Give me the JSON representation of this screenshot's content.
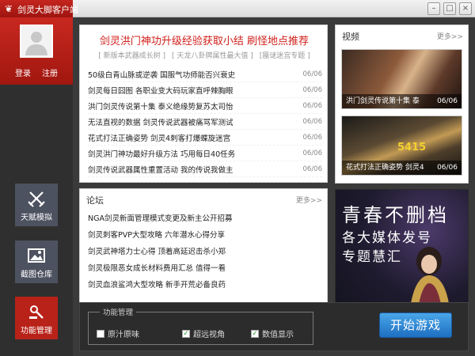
{
  "window": {
    "title": "剑灵大脚客户端",
    "logo_icon": "paw-icon",
    "controls": {
      "minimize": "–",
      "maximize": "□",
      "close": "×"
    }
  },
  "sidebar": {
    "login": "登录",
    "register": "注册",
    "nav": [
      {
        "label": "天赋模拟",
        "icon": "crossed-swords-icon"
      },
      {
        "label": "截图仓库",
        "icon": "picture-icon"
      },
      {
        "label": "功能管理",
        "icon": "tools-icon",
        "active": true
      }
    ]
  },
  "news": {
    "headline": "剑灵洪门神功升级经验获取小结 刷怪地点推荐",
    "sub_links": [
      "[ 新版本武器成长树 ]",
      "[ 天龙八卦牌属性最大值 ]",
      "[蜃谜迷宫专题 ]"
    ],
    "items": [
      {
        "title": "50级白青山脉或逆袭 国服气功师能否兴衰史",
        "date": "06/06"
      },
      {
        "title": "剑灵每日囧图 各职业变大码玩家直呼辣胸眼",
        "date": "06/06"
      },
      {
        "title": "洪门剑灵传说第十集 泰义绝缘势复苏太司怡",
        "date": "06/06"
      },
      {
        "title": "无法直视的数据 剑灵传说武器被痛骂军测试",
        "date": "06/06"
      },
      {
        "title": "花式打法正确姿势 剑灵4刺客打爆蝶旋迷宫",
        "date": "06/06"
      },
      {
        "title": "剑灵洪门神功最好升级方法 巧用每日40任务",
        "date": "06/06"
      },
      {
        "title": "剑灵传说武器属性重置活动 我的传说我做主",
        "date": "06/06"
      }
    ]
  },
  "video": {
    "title": "视频",
    "more": "更多>>",
    "items": [
      {
        "caption": "洪门剑灵传说第十集 泰",
        "date": "06/06"
      },
      {
        "caption": "花式打法正确姿势 剑灵4",
        "date": "06/06",
        "score": "5415"
      }
    ]
  },
  "forum": {
    "title": "论坛",
    "more": "更多>>",
    "items": [
      "NGA剑灵新面管理模式变更及新主公开招募",
      "剑灵刺客PVP大型攻略 六年潜水心得分享",
      "剑灵武神塔力士心得 顶着高延迟击杀小郑",
      "剑灵极限恶女成长材料费用汇总 值得一看",
      "剑灵血浪鲨鸿大型攻略 新手开荒必备良药"
    ]
  },
  "banner": {
    "line1": "青春不删档",
    "line2": "各大媒体发号",
    "line3": "专题慧汇"
  },
  "function_panel": {
    "title": "功能管理",
    "options": [
      {
        "label": "原汁原味",
        "checked": false
      },
      {
        "label": "超远视角",
        "checked": true
      },
      {
        "label": "数值显示",
        "checked": true
      }
    ],
    "start_button": "开始游戏"
  }
}
